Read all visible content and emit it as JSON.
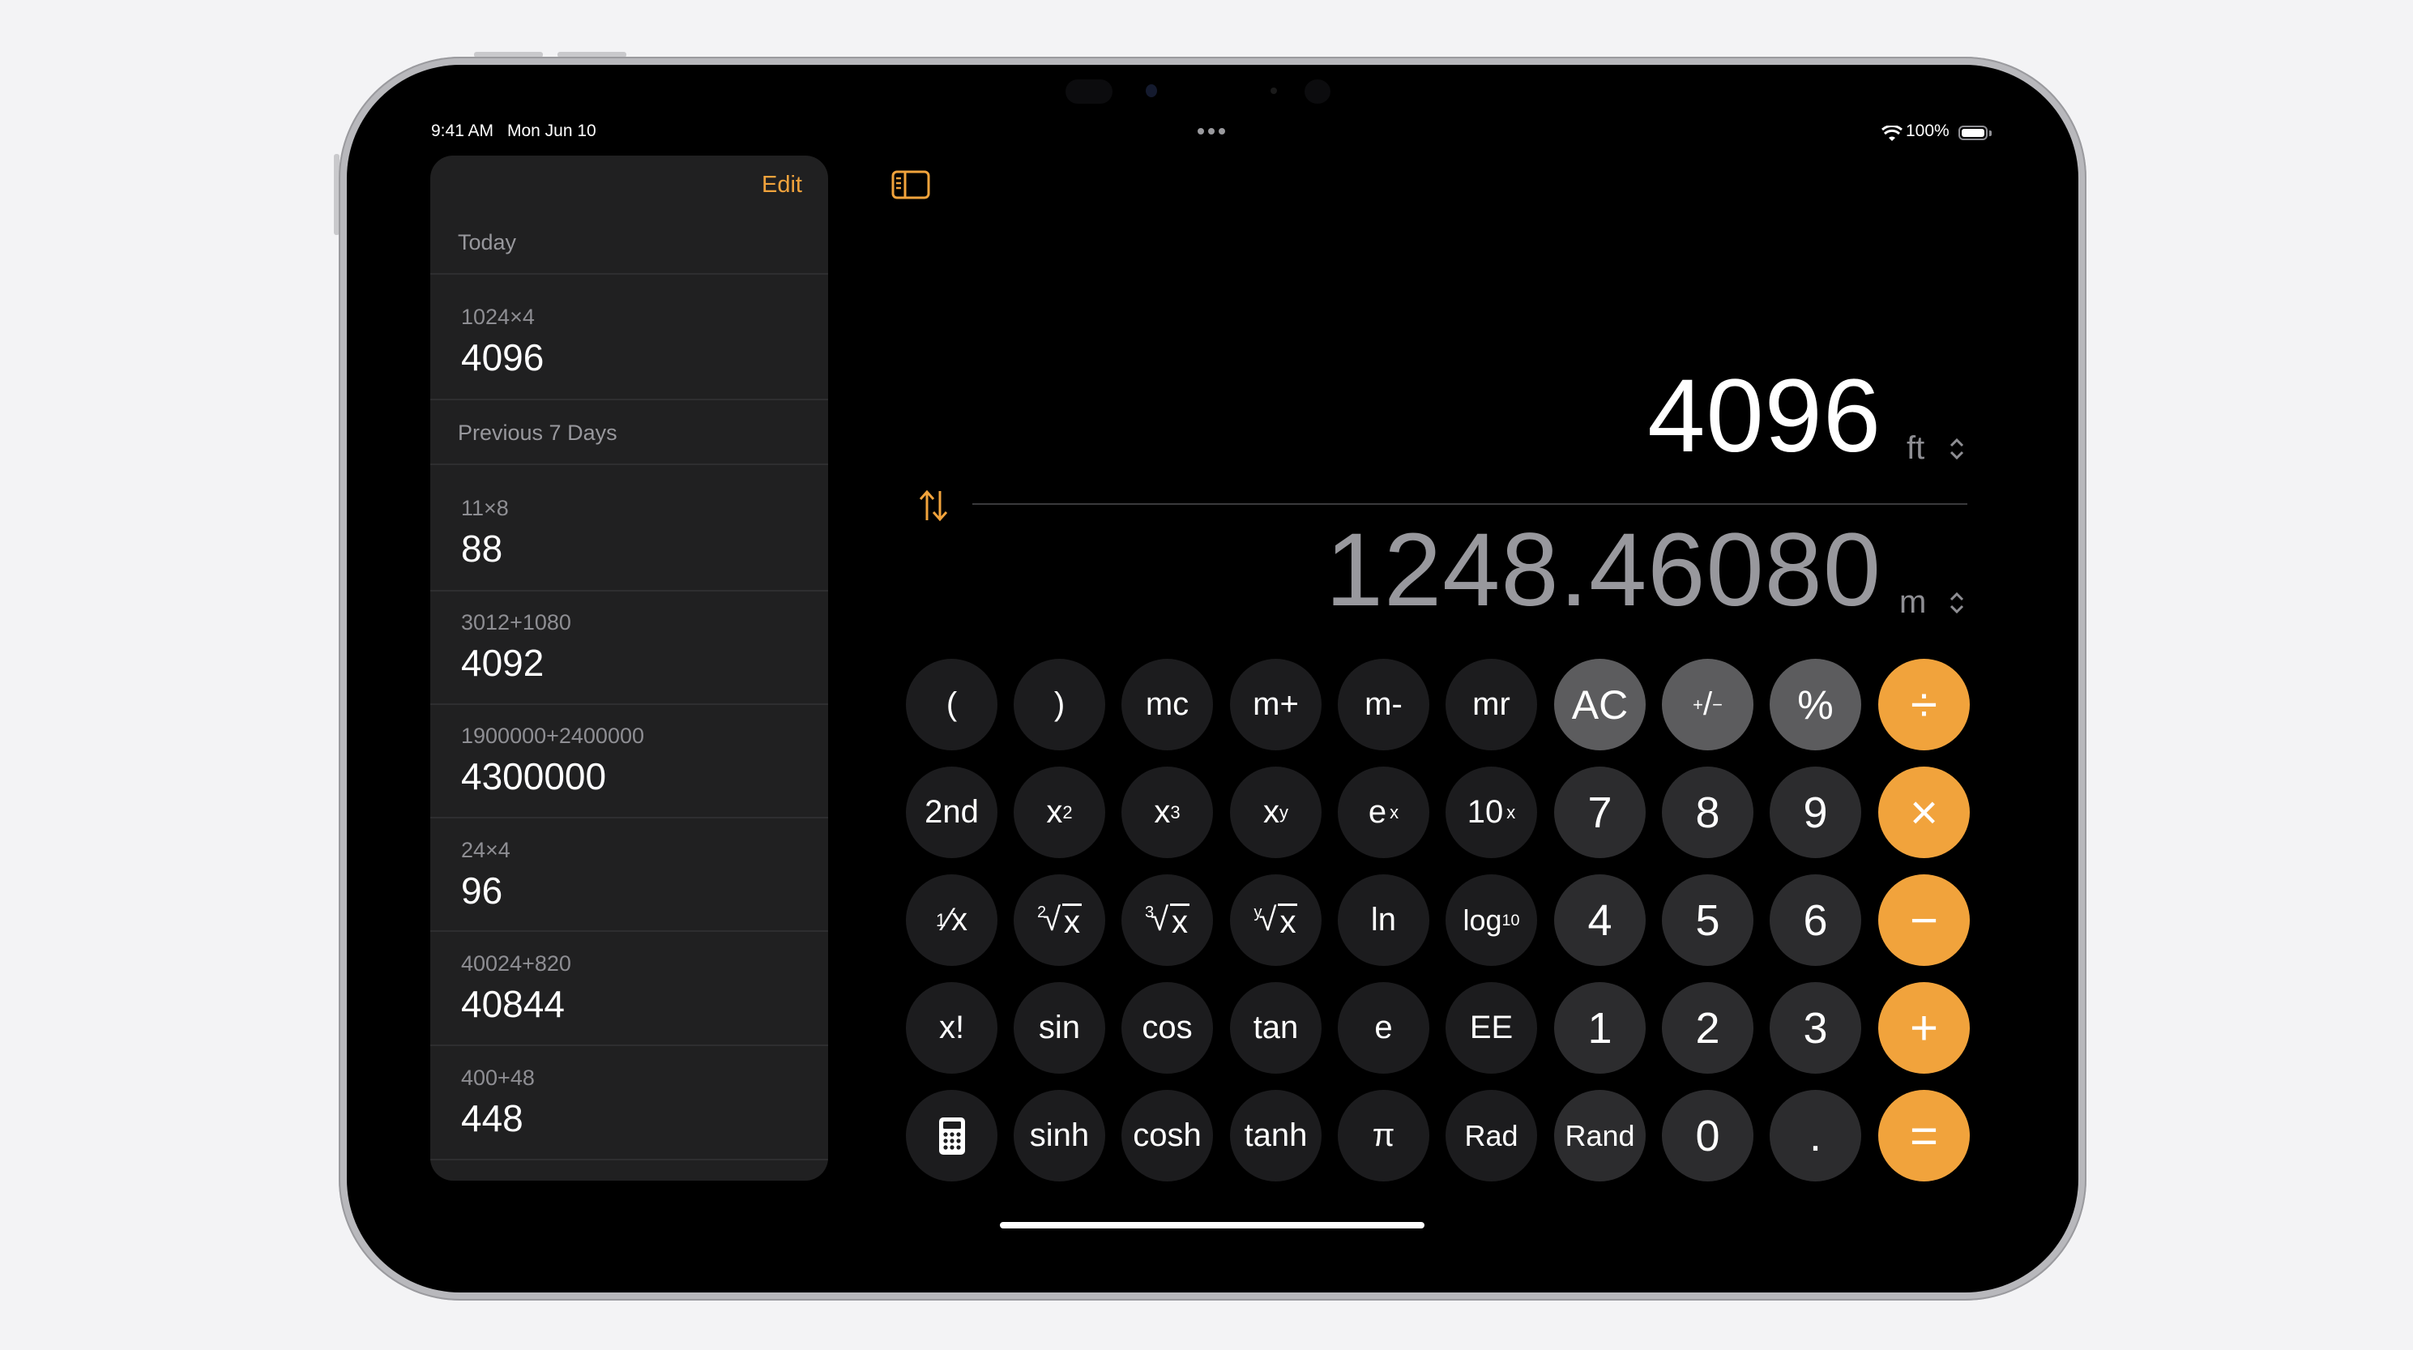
{
  "status_bar": {
    "time": "9:41 AM",
    "date": "Mon Jun 10",
    "battery": "100%",
    "wifi_icon": "wifi-icon",
    "battery_icon": "battery-icon"
  },
  "sidebar": {
    "edit_label": "Edit",
    "sections": [
      {
        "title": "Today",
        "items": [
          {
            "expression": "1024×4",
            "result": "4096"
          }
        ]
      },
      {
        "title": "Previous 7 Days",
        "items": [
          {
            "expression": "11×8",
            "result": "88"
          },
          {
            "expression": "3012+1080",
            "result": "4092"
          },
          {
            "expression": "1900000+2400000",
            "result": "4300000"
          },
          {
            "expression": "24×4",
            "result": "96"
          },
          {
            "expression": "40024+820",
            "result": "40844"
          },
          {
            "expression": "400+48",
            "result": "448"
          }
        ]
      }
    ]
  },
  "display": {
    "input_value": "4096",
    "input_unit": "ft",
    "output_value": "1248.46080",
    "output_unit": "m"
  },
  "keypad": {
    "row1": [
      "(",
      ")",
      "mc",
      "m+",
      "m-",
      "mr",
      "AC",
      "+/-",
      "%",
      "÷"
    ],
    "row2": [
      "2nd",
      "x²",
      "x³",
      "xʸ",
      "eˣ",
      "10ˣ",
      "7",
      "8",
      "9",
      "×"
    ],
    "row3": [
      "1/x",
      "²√x",
      "³√x",
      "ʸ√x",
      "ln",
      "log₁₀",
      "4",
      "5",
      "6",
      "−"
    ],
    "row4": [
      "x!",
      "sin",
      "cos",
      "tan",
      "e",
      "EE",
      "1",
      "2",
      "3",
      "+"
    ],
    "row5": [
      "calculator-icon",
      "sinh",
      "cosh",
      "tanh",
      "π",
      "Rad",
      "Rand",
      "0",
      ".",
      "="
    ],
    "labels": {
      "lparen": "(",
      "rparen": ")",
      "mc": "mc",
      "mplus": "m+",
      "mminus": "m-",
      "mr": "mr",
      "ac": "AC",
      "percent": "%",
      "divide": "÷",
      "second": "2nd",
      "x": "x",
      "e": "e",
      "ten": "10",
      "sup2": "2",
      "sup3": "3",
      "supy": "y",
      "supx": "x",
      "one": "1",
      "ln": "ln",
      "log": "log",
      "sub10": "10",
      "factorial": "x!",
      "sin": "sin",
      "cos": "cos",
      "tan": "tan",
      "ee": "EE",
      "sinh": "sinh",
      "cosh": "cosh",
      "tanh": "tanh",
      "pi": "π",
      "rad": "Rad",
      "rand": "Rand",
      "d0": "0",
      "d1": "1",
      "d2": "2",
      "d3": "3",
      "d4": "4",
      "d5": "5",
      "d6": "6",
      "d7": "7",
      "d8": "8",
      "d9": "9",
      "dot": ".",
      "times": "×",
      "minus": "−",
      "plus": "+",
      "equals": "=",
      "plusminus_a": "+",
      "plusminus_b": "/",
      "plusminus_c": "−",
      "idx2": "2",
      "idx3": "3",
      "idxy": "y"
    }
  },
  "colors": {
    "accent": "#f1a33c",
    "function_key": "#1c1c1e",
    "number_key": "#2c2c2e",
    "utility_key": "#5c5c5e",
    "sidebar_bg": "#202021"
  }
}
